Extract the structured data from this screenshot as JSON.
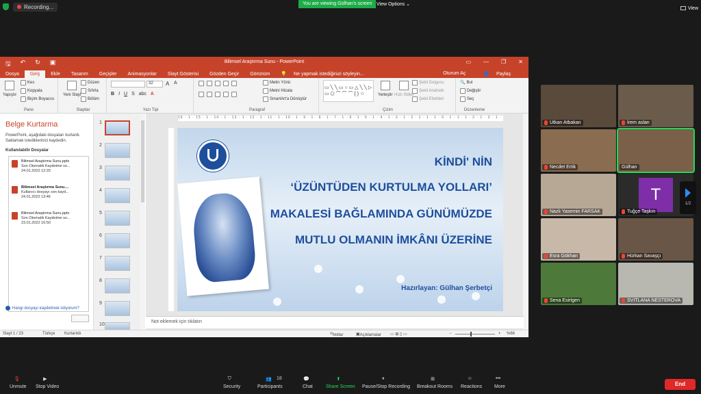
{
  "zoom_top": {
    "recording": "Recording...",
    "viewing": "You are viewing Gülhan's screen",
    "view_options": "View Options",
    "view": "View"
  },
  "ppt": {
    "title": "Bilimsel Araştırma Sunu - PowerPoint",
    "tabs": [
      "Dosya",
      "Giriş",
      "Ekle",
      "Tasarım",
      "Geçişler",
      "Animasyonlar",
      "Slayt Gösterisi",
      "Gözden Geçir",
      "Görünüm"
    ],
    "tell_me": "Ne yapmak istediğinizi söyleyin...",
    "signin": "Oturum Aç",
    "share": "Paylaş",
    "ribbon": {
      "paste": "Yapıştır",
      "cut": "Kes",
      "copy": "Kopyala",
      "format_painter": "Biçim Boyacısı",
      "clipboard": "Pano",
      "new_slide": "Yeni Slayt",
      "layout": "Düzen",
      "reset": "Sıfırla",
      "section": "Bölüm",
      "slides": "Slaytlar",
      "font_size": "32",
      "font": "Yazı Tipi",
      "text_direction": "Metin Yönü",
      "align_text": "Metni Hizala",
      "smartart": "SmartArt'a Dönüştür",
      "paragraph": "Paragraf",
      "arrange": "Yerleştir",
      "quick_styles": "Hızlı Stiller",
      "shape_fill": "Şekil Dolgusu",
      "shape_outline": "Şekil Anahattı",
      "shape_effects": "Şekil Efektleri",
      "drawing": "Çizim",
      "find": "Bul",
      "replace": "Değiştir",
      "select": "Seç",
      "editing": "Düzenleme"
    },
    "recovery": {
      "title": "Belge Kurtarma",
      "desc": "PowerPoint, aşağıdaki dosyaları kurtardı. Saklamak istediklerinizi kaydedin.",
      "available": "Kullanılabilir Dosyalar",
      "files": [
        {
          "name": "Bilimsel Araştırma Sunu.pptx",
          "status": "Son Otomatik Kaydetme so...",
          "date": "24.01.2022 12:20"
        },
        {
          "name": "Bilimsel Araştırma Sunu....",
          "status": "Kullanıcı dosyayı son kayd...",
          "date": "24.01.2022 13:46"
        },
        {
          "name": "Bilimsel Araştırma Sunu.pptx",
          "status": "Son Otomatik Kaydetme so...",
          "date": "23.01.2022 16:50"
        }
      ],
      "question": "Hangi dosyayı kaydetmek istiyorum?",
      "close": "Kapat"
    },
    "thumb_numbers": [
      "1",
      "2",
      "3",
      "4",
      "5",
      "6",
      "7",
      "8",
      "9",
      "10"
    ],
    "ruler": "16 · 1 · 15 · 1 · 14 · 1 · 13 · 1 · 12 · 1 · 11 · 1 · 10 · 1 · 9 · 1 · 8 · 1 · 7 · 1 · 6 · 1 · 5 · 1 · 4 · 1 · 3 · 1 · 2 · 1 · 1 · 1 · 0 · 1 · 1 · 1 · 2 · 1 · 3 · 1 · 4 · 1 · 5 · 1 · 6 · 1 · 7 · 1 · 8 · 1 · 9 · 1 · 10 · 1 · 11 · 1 · 12 · 1 · 13 · 1 · 14 · 1 · 15 · 1 · 16",
    "slide": {
      "line1": "KİNDİ' NİN",
      "line2": "‘ÜZÜNTÜDEN KURTULMA YOLLARI’",
      "line3": "MAKALESİ BAĞLAMINDA GÜNÜMÜZDE",
      "line4": "MUTLU OLMANIN İMKÂNI ÜZERİNE",
      "presenter": "Hazırlayan: Gülhan Şerbetçi"
    },
    "notes_placeholder": "Not eklemek için tıklatın",
    "status": {
      "slide": "Slayt 1 / 23",
      "lang": "Türkçe",
      "recovered": "Kurtarıldı",
      "notes": "Notlar",
      "comments": "Açıklamalar",
      "zoom": "%66"
    }
  },
  "participants": [
    {
      "name": "Utkan Atbakan",
      "bg": "#5a4a3c"
    },
    {
      "name": "İrem aslan",
      "bg": "#6b5b4a"
    },
    {
      "name": "Necdet Ertik",
      "bg": "#8a6c50"
    },
    {
      "name": "Gülhan",
      "bg": "#7a6048"
    },
    {
      "name": "Nazlı Yasemin FARSAK",
      "bg": "#b7a795"
    },
    {
      "name": "Tuğçe Taşkın",
      "bg": "#2b2b2b",
      "letter": "T"
    },
    {
      "name": "Esra Gökhan",
      "bg": "#c8b8a8"
    },
    {
      "name": "Hürkan Savaşçı",
      "bg": "#6a5646"
    },
    {
      "name": "Sena Esirtgen",
      "bg": "#4d7a3a"
    },
    {
      "name": "SVITLANA NESTEROVA",
      "bg": "#b8b8b0"
    }
  ],
  "pager": "1/2",
  "toolbar": {
    "unmute": "Unmute",
    "stop_video": "Stop Video",
    "security": "Security",
    "participants": "Participants",
    "participants_count": "18",
    "chat": "Chat",
    "share_screen": "Share Screen",
    "pause_recording": "Pause/Stop Recording",
    "breakout": "Breakout Rooms",
    "reactions": "Reactions",
    "more": "More",
    "end": "End"
  },
  "colors": {
    "ppt_accent": "#c6432a",
    "zoom_green": "#1eab49",
    "end_red": "#e02828",
    "slide_text": "#1d4f9c"
  }
}
